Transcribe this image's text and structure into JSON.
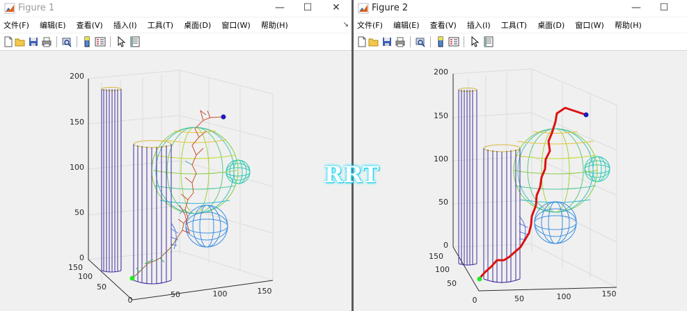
{
  "windows": [
    {
      "title": "Figure 1",
      "menu": [
        "文件(F)",
        "编辑(E)",
        "查看(V)",
        "插入(I)",
        "工具(T)",
        "桌面(D)",
        "窗口(W)",
        "帮助(H)"
      ],
      "menu_overflow": "↘",
      "controls": [
        "—",
        "☐",
        "✕"
      ],
      "z_ticks": [
        "200",
        "150",
        "100",
        "50",
        "0"
      ],
      "y_ticks": [
        "150",
        "100",
        "50"
      ],
      "x_ticks": [
        "0",
        "50",
        "100",
        "150"
      ]
    },
    {
      "title": "Figure 2",
      "menu": [
        "文件(F)",
        "编辑(E)",
        "查看(V)",
        "插入(I)",
        "工具(T)",
        "桌面(D)",
        "窗口(W)",
        "帮助(H)"
      ],
      "controls": [
        "—",
        "☐"
      ],
      "z_ticks": [
        "200",
        "150",
        "100",
        "50",
        "0"
      ],
      "y_ticks": [
        "150",
        "100",
        "50"
      ],
      "x_ticks": [
        "0",
        "50",
        "100",
        "150"
      ]
    }
  ],
  "overlay_text": "RRT",
  "colors": {
    "cylinder": "#3d2a9b",
    "cylinder_top": "#d6b83a",
    "start": "#22ee22",
    "goal": "#1c1cb8",
    "path_final": "#dd1111",
    "grid": "#dcdcdc",
    "axes": "#2a2a2a"
  },
  "icons": [
    "new-file-icon",
    "open-folder-icon",
    "save-icon",
    "print-icon",
    "print-preview-icon",
    "colorbar-icon",
    "legend-icon",
    "pointer-icon",
    "property-inspector-icon"
  ]
}
